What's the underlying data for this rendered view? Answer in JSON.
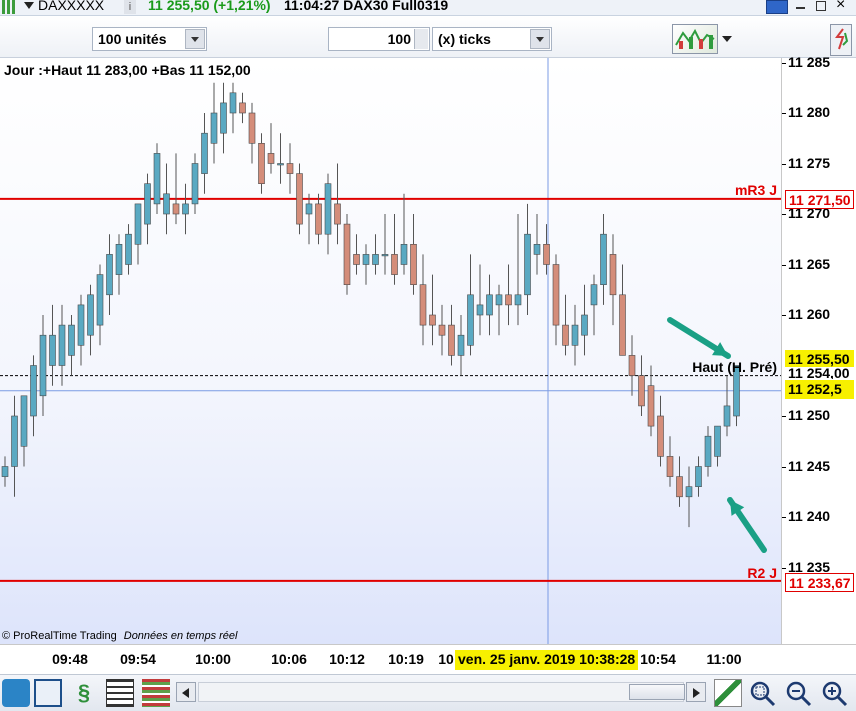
{
  "titlebar": {
    "symbol": "DAXXXXX",
    "info_glyph": "i",
    "quote": "11 255,50 (+1,21%)",
    "time_instrument": "11:04:27 DAX30 Full0319",
    "window_buttons": [
      "keyboard-icon",
      "minimize-icon",
      "maximize-icon",
      "close-icon"
    ]
  },
  "toolbar": {
    "units_select": "100 unités",
    "ticks_value": "100",
    "ticks_select": "(x) ticks"
  },
  "chart": {
    "info_text": "Jour :+Haut 11 283,00 +Bas 11 152,00",
    "hline_r3_label": "mR3 J",
    "hline_r2_label": "R2 J",
    "hline_prev_high_label": "Haut (H. Pré)",
    "footer_brand": "© ProRealTime Trading",
    "footer_note": "Données en temps réel",
    "colors": {
      "up": "#5aa9c2",
      "down": "#d48d7a",
      "resistance": "#e00000",
      "crosshair": "#7b9be4",
      "annotation": "#1aa085"
    }
  },
  "price_axis": {
    "ticks": [
      "11 285",
      "11 280",
      "11 275",
      "11 270",
      "11 265",
      "11 260",
      "11 250",
      "11 245",
      "11 240",
      "11 235"
    ],
    "tag_r3": "11 271,50",
    "tag_last": "11 255,50",
    "tag_prev_high": "11 254,00",
    "tag_cursor": "11 252,5",
    "tag_r2": "11 233,67"
  },
  "time_axis": {
    "ticks": [
      "09:48",
      "09:54",
      "10:00",
      "10:06",
      "10:12",
      "10:19",
      "10",
      "10:54",
      "11:00"
    ],
    "cursor_label": "ven. 25 janv. 2019 10:38:28"
  },
  "chart_data": {
    "type": "candlestick",
    "x_range": [
      "09:48",
      "11:00"
    ],
    "ylim": [
      11230,
      11287
    ],
    "candles": [
      {
        "o": 11244,
        "h": 11246,
        "l": 11243,
        "c": 11245
      },
      {
        "o": 11245,
        "h": 11252,
        "l": 11242,
        "c": 11250
      },
      {
        "o": 11247,
        "h": 11251,
        "l": 11245,
        "c": 11252
      },
      {
        "o": 11250,
        "h": 11256,
        "l": 11248,
        "c": 11255
      },
      {
        "o": 11252,
        "h": 11260,
        "l": 11250,
        "c": 11258
      },
      {
        "o": 11255,
        "h": 11261,
        "l": 11253,
        "c": 11258
      },
      {
        "o": 11255,
        "h": 11261,
        "l": 11253,
        "c": 11259
      },
      {
        "o": 11256,
        "h": 11260,
        "l": 11254,
        "c": 11259
      },
      {
        "o": 11257,
        "h": 11262,
        "l": 11255,
        "c": 11261
      },
      {
        "o": 11258,
        "h": 11263,
        "l": 11256,
        "c": 11262
      },
      {
        "o": 11259,
        "h": 11265,
        "l": 11257,
        "c": 11264
      },
      {
        "o": 11262,
        "h": 11268,
        "l": 11260,
        "c": 11266
      },
      {
        "o": 11264,
        "h": 11268,
        "l": 11262,
        "c": 11267
      },
      {
        "o": 11265,
        "h": 11269,
        "l": 11264,
        "c": 11268
      },
      {
        "o": 11267,
        "h": 11271,
        "l": 11265,
        "c": 11271
      },
      {
        "o": 11269,
        "h": 11274,
        "l": 11267,
        "c": 11273
      },
      {
        "o": 11271,
        "h": 11277,
        "l": 11270,
        "c": 11276
      },
      {
        "o": 11270,
        "h": 11275,
        "l": 11268,
        "c": 11272
      },
      {
        "o": 11271,
        "h": 11276,
        "l": 11269,
        "c": 11270
      },
      {
        "o": 11270,
        "h": 11273,
        "l": 11268,
        "c": 11271
      },
      {
        "o": 11271,
        "h": 11276,
        "l": 11270,
        "c": 11275
      },
      {
        "o": 11274,
        "h": 11280,
        "l": 11272,
        "c": 11278
      },
      {
        "o": 11277,
        "h": 11283,
        "l": 11275,
        "c": 11280
      },
      {
        "o": 11278,
        "h": 11283,
        "l": 11276,
        "c": 11281
      },
      {
        "o": 11280,
        "h": 11283,
        "l": 11278,
        "c": 11282
      },
      {
        "o": 11281,
        "h": 11282,
        "l": 11279,
        "c": 11280
      },
      {
        "o": 11280,
        "h": 11281,
        "l": 11275,
        "c": 11277
      },
      {
        "o": 11277,
        "h": 11278,
        "l": 11272,
        "c": 11273
      },
      {
        "o": 11276,
        "h": 11279,
        "l": 11274,
        "c": 11275
      },
      {
        "o": 11275,
        "h": 11278,
        "l": 11273,
        "c": 11275
      },
      {
        "o": 11275,
        "h": 11277,
        "l": 11272,
        "c": 11274
      },
      {
        "o": 11274,
        "h": 11275,
        "l": 11268,
        "c": 11269
      },
      {
        "o": 11270,
        "h": 11272,
        "l": 11267,
        "c": 11271
      },
      {
        "o": 11271,
        "h": 11272,
        "l": 11267,
        "c": 11268
      },
      {
        "o": 11268,
        "h": 11274,
        "l": 11266,
        "c": 11273
      },
      {
        "o": 11271,
        "h": 11275,
        "l": 11267,
        "c": 11269
      },
      {
        "o": 11269,
        "h": 11270,
        "l": 11262,
        "c": 11263
      },
      {
        "o": 11266,
        "h": 11268,
        "l": 11264,
        "c": 11265
      },
      {
        "o": 11265,
        "h": 11267,
        "l": 11263,
        "c": 11266
      },
      {
        "o": 11265,
        "h": 11268,
        "l": 11264,
        "c": 11266
      },
      {
        "o": 11266,
        "h": 11270,
        "l": 11264,
        "c": 11266
      },
      {
        "o": 11266,
        "h": 11270,
        "l": 11263,
        "c": 11264
      },
      {
        "o": 11265,
        "h": 11272,
        "l": 11264,
        "c": 11267
      },
      {
        "o": 11267,
        "h": 11270,
        "l": 11262,
        "c": 11263
      },
      {
        "o": 11263,
        "h": 11266,
        "l": 11257,
        "c": 11259
      },
      {
        "o": 11260,
        "h": 11264,
        "l": 11257,
        "c": 11259
      },
      {
        "o": 11259,
        "h": 11261,
        "l": 11256,
        "c": 11258
      },
      {
        "o": 11259,
        "h": 11261,
        "l": 11255,
        "c": 11256
      },
      {
        "o": 11256,
        "h": 11260,
        "l": 11254,
        "c": 11258
      },
      {
        "o": 11257,
        "h": 11266,
        "l": 11256,
        "c": 11262
      },
      {
        "o": 11260,
        "h": 11265,
        "l": 11258,
        "c": 11261
      },
      {
        "o": 11260,
        "h": 11264,
        "l": 11258,
        "c": 11262
      },
      {
        "o": 11261,
        "h": 11263,
        "l": 11258,
        "c": 11262
      },
      {
        "o": 11262,
        "h": 11265,
        "l": 11259,
        "c": 11261
      },
      {
        "o": 11261,
        "h": 11270,
        "l": 11259,
        "c": 11262
      },
      {
        "o": 11262,
        "h": 11271,
        "l": 11260,
        "c": 11268
      },
      {
        "o": 11266,
        "h": 11270,
        "l": 11264,
        "c": 11267
      },
      {
        "o": 11267,
        "h": 11269,
        "l": 11264,
        "c": 11265
      },
      {
        "o": 11265,
        "h": 11266,
        "l": 11257,
        "c": 11259
      },
      {
        "o": 11259,
        "h": 11262,
        "l": 11256,
        "c": 11257
      },
      {
        "o": 11257,
        "h": 11261,
        "l": 11255,
        "c": 11259
      },
      {
        "o": 11258,
        "h": 11263,
        "l": 11256,
        "c": 11260
      },
      {
        "o": 11261,
        "h": 11264,
        "l": 11258,
        "c": 11263
      },
      {
        "o": 11263,
        "h": 11270,
        "l": 11261,
        "c": 11268
      },
      {
        "o": 11266,
        "h": 11268,
        "l": 11259,
        "c": 11262
      },
      {
        "o": 11262,
        "h": 11265,
        "l": 11256,
        "c": 11256
      },
      {
        "o": 11256,
        "h": 11258,
        "l": 11252,
        "c": 11254
      },
      {
        "o": 11254,
        "h": 11256,
        "l": 11250,
        "c": 11251
      },
      {
        "o": 11253,
        "h": 11255,
        "l": 11248,
        "c": 11249
      },
      {
        "o": 11250,
        "h": 11252,
        "l": 11245,
        "c": 11246
      },
      {
        "o": 11246,
        "h": 11248,
        "l": 11243,
        "c": 11244
      },
      {
        "o": 11244,
        "h": 11246,
        "l": 11241,
        "c": 11242
      },
      {
        "o": 11242,
        "h": 11245,
        "l": 11239,
        "c": 11243
      },
      {
        "o": 11243,
        "h": 11246,
        "l": 11242,
        "c": 11245
      },
      {
        "o": 11245,
        "h": 11249,
        "l": 11244,
        "c": 11248
      },
      {
        "o": 11246,
        "h": 11249,
        "l": 11245,
        "c": 11249
      },
      {
        "o": 11249,
        "h": 11254,
        "l": 11248,
        "c": 11251
      },
      {
        "o": 11250,
        "h": 11255,
        "l": 11249,
        "c": 11255
      }
    ],
    "hlines": [
      {
        "name": "mR3 J",
        "value": 11271.5
      },
      {
        "name": "Haut (H. Pré)",
        "value": 11254
      },
      {
        "name": "R2 J",
        "value": 11233.67
      }
    ],
    "cursor": {
      "price": 11252.5,
      "time": "ven. 25 janv. 2019 10:38:28"
    }
  }
}
